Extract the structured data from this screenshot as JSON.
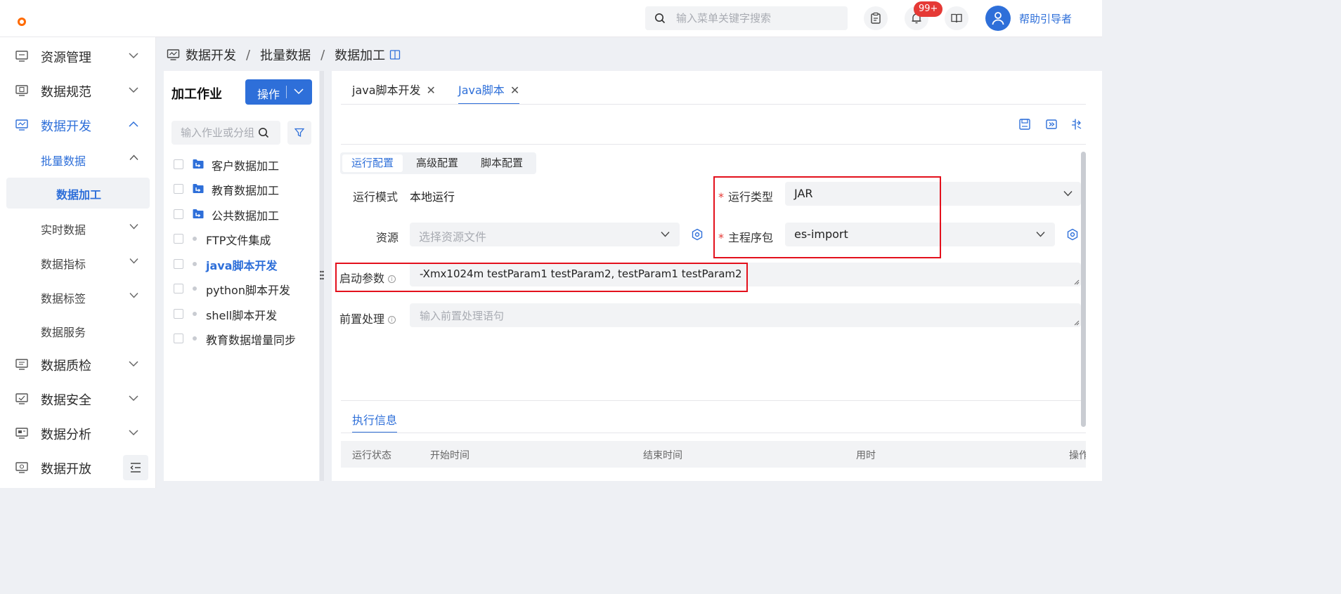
{
  "header": {
    "search_placeholder": "输入菜单关键字搜索",
    "notification_badge": "99+",
    "guide_link": "帮助引导者"
  },
  "sidebar": {
    "items": [
      {
        "label": "资源管理",
        "icon": "monitor-icon"
      },
      {
        "label": "数据规范",
        "icon": "document-monitor-icon"
      },
      {
        "label": "数据开发",
        "icon": "code-monitor-icon"
      },
      {
        "label": "数据质检",
        "icon": "list-icon"
      },
      {
        "label": "数据安全",
        "icon": "check-monitor-icon"
      },
      {
        "label": "数据分析",
        "icon": "chart-monitor-icon"
      },
      {
        "label": "数据开放",
        "icon": "share-monitor-icon"
      }
    ],
    "sub_items": [
      {
        "label": "批量数据"
      },
      {
        "label": "实时数据"
      },
      {
        "label": "数据指标"
      },
      {
        "label": "数据标签"
      },
      {
        "label": "数据服务"
      }
    ],
    "selected_leaf": "数据加工"
  },
  "breadcrumb": {
    "items": [
      "数据开发",
      "批量数据",
      "数据加工"
    ],
    "separator": "/"
  },
  "job_panel": {
    "title": "加工作业",
    "action_button": "操作",
    "search_placeholder": "输入作业或分组",
    "items": [
      {
        "label": "客户数据加工",
        "type": "folder"
      },
      {
        "label": "教育数据加工",
        "type": "folder"
      },
      {
        "label": "公共数据加工",
        "type": "folder"
      },
      {
        "label": "FTP文件集成",
        "type": "job"
      },
      {
        "label": "java脚本开发",
        "type": "job"
      },
      {
        "label": "python脚本开发",
        "type": "job"
      },
      {
        "label": "shell脚本开发",
        "type": "job"
      },
      {
        "label": "教育数据增量同步",
        "type": "job"
      }
    ]
  },
  "tabs": [
    {
      "label": "java脚本开发",
      "close": "✕"
    },
    {
      "label": "Java脚本",
      "close": "✕"
    }
  ],
  "config_tabs": [
    "运行配置",
    "高级配置",
    "脚本配置"
  ],
  "form": {
    "run_mode_label": "运行模式",
    "run_mode_value": "本地运行",
    "run_type_label": "运行类型",
    "run_type_value": "JAR",
    "resource_label": "资源",
    "resource_placeholder": "选择资源文件",
    "main_package_label": "主程序包",
    "main_package_value": "es-import",
    "startup_params_label": "启动参数",
    "startup_params_value": "-Xmx1024m testParam1 testParam2, testParam1 testParam2",
    "pre_process_label": "前置处理",
    "pre_process_placeholder": "输入前置处理语句",
    "required_mark": "*",
    "info_mark": "i"
  },
  "execution": {
    "tab_label": "执行信息",
    "columns": [
      "运行状态",
      "开始时间",
      "结束时间",
      "用时",
      "操作"
    ]
  },
  "colors": {
    "primary": "#2e6fd9",
    "highlight": "#e3101c",
    "badge": "#e53935"
  }
}
